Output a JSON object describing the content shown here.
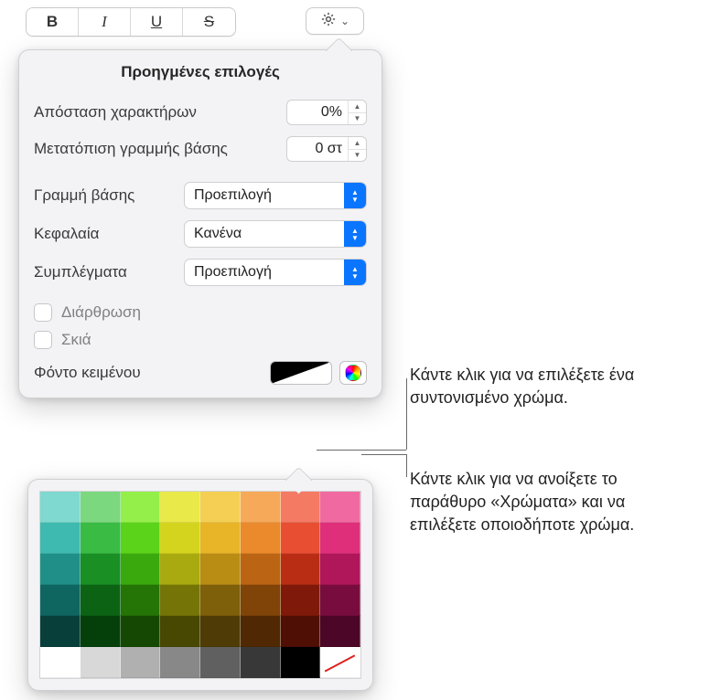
{
  "toolbar": {
    "bold": "B",
    "italic": "I",
    "underline": "U",
    "strike": "S"
  },
  "panel": {
    "title": "Προηγμένες επιλογές",
    "charSpacing": {
      "label": "Απόσταση χαρακτήρων",
      "value": "0%"
    },
    "baselineShift": {
      "label": "Μετατόπιση γραμμής βάσης",
      "value": "0 στ"
    },
    "baseline": {
      "label": "Γραμμή βάσης",
      "value": "Προεπιλογή"
    },
    "caps": {
      "label": "Κεφαλαία",
      "value": "Κανένα"
    },
    "ligatures": {
      "label": "Συμπλέγματα",
      "value": "Προεπιλογή"
    },
    "articulation": "Διάρθρωση",
    "shadow": "Σκιά",
    "textBg": "Φόντο κειμένου"
  },
  "callouts": {
    "coordinatedColor": "Κάντε κλικ για να επιλέξετε ένα συντονισμένο χρώμα.",
    "colorsWindow": "Κάντε κλικ για να ανοίξετε το παράθυρο «Χρώματα» και να επιλέξετε οποιοδήποτε χρώμα."
  },
  "swatches": [
    [
      "#7fd9d0",
      "#7bd87f",
      "#94ef4a",
      "#e9e94a",
      "#f5cf54",
      "#f7a95a",
      "#f57a63",
      "#f06aa1"
    ],
    [
      "#3fbab0",
      "#39bb44",
      "#5bd31a",
      "#d4d41f",
      "#e8b428",
      "#ea8a2c",
      "#e84e32",
      "#df2f7a"
    ],
    [
      "#1f8f87",
      "#1a8f24",
      "#3aa90e",
      "#a9a910",
      "#b98c14",
      "#bb6514",
      "#b92d15",
      "#b0165a"
    ],
    [
      "#0f6560",
      "#0b6313",
      "#247406",
      "#757507",
      "#7e5f0a",
      "#804308",
      "#7f1a0a",
      "#790c3e"
    ],
    [
      "#083f3b",
      "#05400a",
      "#154803",
      "#484803",
      "#4f3b05",
      "#502904",
      "#500f05",
      "#4c0627"
    ],
    [
      "#ffffff",
      "#d8d8d8",
      "#b0b0b0",
      "#888888",
      "#606060",
      "#383838",
      "#000000",
      "nocolor"
    ]
  ]
}
